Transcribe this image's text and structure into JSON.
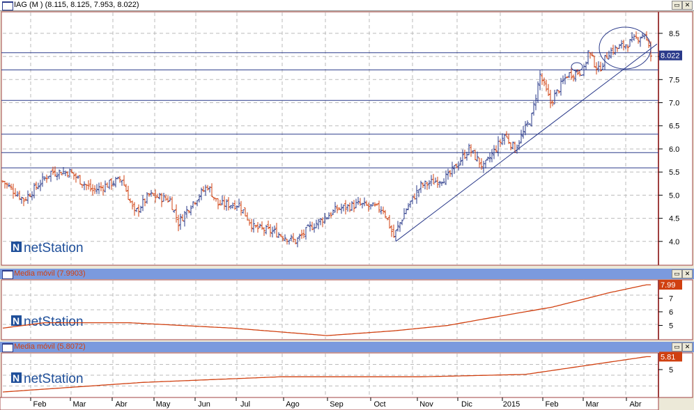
{
  "main_panel": {
    "title": "IAG (M ) (8.115, 8.125, 7.953, 8.022)",
    "last_price_label": "8.022",
    "y_ticks": [
      "8.5",
      "8.0",
      "7.5",
      "7.0",
      "6.5",
      "6.0",
      "5.5",
      "5.0",
      "4.5",
      "4.0"
    ],
    "logo": "netStation"
  },
  "ma1_panel": {
    "title": "Media móvil (7.9903)",
    "last_label": "7.99",
    "y_ticks": [
      "7",
      "6",
      "5"
    ],
    "logo": "netStation"
  },
  "ma2_panel": {
    "title": "Media móvil (5.8072)",
    "last_label": "5.81",
    "y_ticks": [
      "5"
    ],
    "logo": "netStation"
  },
  "buttons": {
    "maximize": "▭",
    "close": "✕"
  },
  "time_axis": [
    "Feb",
    "Mar",
    "Abr",
    "May",
    "Jun",
    "Jul",
    "Ago",
    "Sep",
    "Oct",
    "Nov",
    "Dic",
    "2015",
    "Feb",
    "Mar",
    "Abr"
  ],
  "colors": {
    "up": "#2a3a8a",
    "down": "#d04010",
    "line": "#2a3a8a",
    "ma": "#d04010",
    "titlebar": "#7b9ade"
  },
  "chart_data": {
    "type": "ohlc",
    "price_anchors": [
      [
        0,
        5.3
      ],
      [
        10,
        4.9
      ],
      [
        23,
        5.5
      ],
      [
        32,
        5.5
      ],
      [
        43,
        5.1
      ],
      [
        57,
        5.35
      ],
      [
        63,
        4.6
      ],
      [
        70,
        5.0
      ],
      [
        80,
        4.9
      ],
      [
        84,
        4.4
      ],
      [
        90,
        4.8
      ],
      [
        98,
        5.2
      ],
      [
        103,
        4.8
      ],
      [
        113,
        4.8
      ],
      [
        120,
        4.3
      ],
      [
        130,
        4.2
      ],
      [
        140,
        4.0
      ],
      [
        147,
        4.3
      ],
      [
        160,
        4.7
      ],
      [
        170,
        4.8
      ],
      [
        182,
        4.7
      ],
      [
        187,
        4.1
      ],
      [
        193,
        4.7
      ],
      [
        200,
        5.2
      ],
      [
        213,
        5.4
      ],
      [
        223,
        6.0
      ],
      [
        230,
        5.6
      ],
      [
        240,
        6.3
      ],
      [
        245,
        6.0
      ],
      [
        253,
        6.7
      ],
      [
        257,
        7.6
      ],
      [
        262,
        7.0
      ],
      [
        270,
        7.6
      ],
      [
        278,
        7.7
      ],
      [
        280,
        8.1
      ],
      [
        285,
        7.7
      ],
      [
        290,
        8.1
      ],
      [
        300,
        8.3
      ],
      [
        307,
        8.5
      ],
      [
        310,
        8.02
      ]
    ],
    "horizontal_levels": [
      8.08,
      7.71,
      7.05,
      6.32,
      5.92,
      5.59
    ],
    "trendline": [
      [
        188,
        4.0
      ],
      [
        313,
        8.27
      ]
    ],
    "main_ylim": [
      3.5,
      8.95
    ],
    "ma1": {
      "anchors": [
        [
          0,
          4.8
        ],
        [
          20,
          5.2
        ],
        [
          60,
          5.2
        ],
        [
          110,
          4.8
        ],
        [
          155,
          4.25
        ],
        [
          187,
          4.6
        ],
        [
          213,
          5.0
        ],
        [
          233,
          5.55
        ],
        [
          263,
          6.35
        ],
        [
          290,
          7.4
        ],
        [
          308,
          7.99
        ]
      ],
      "ylim": [
        4.0,
        8.3
      ]
    },
    "ma2": {
      "anchors": [
        [
          0,
          3.6
        ],
        [
          67,
          4.2
        ],
        [
          133,
          4.55
        ],
        [
          200,
          4.55
        ],
        [
          250,
          4.7
        ],
        [
          308,
          5.81
        ]
      ],
      "ylim": [
        3.3,
        6.0
      ]
    }
  }
}
